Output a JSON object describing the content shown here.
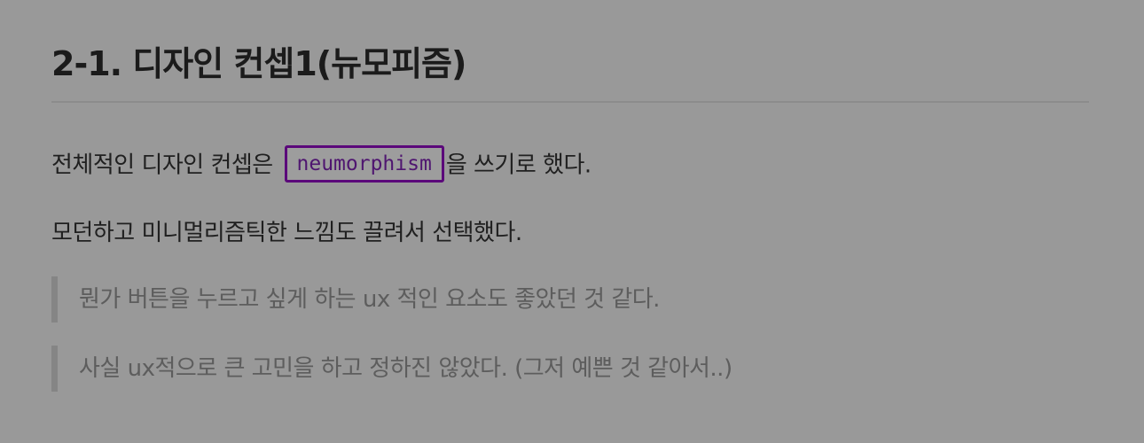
{
  "heading": {
    "title": "2-1. 디자인 컨셉1(뉴모피즘)"
  },
  "body": {
    "para1_before": "전체적인 디자인 컨셉은 ",
    "para1_code": "neumorphism",
    "para1_after": "을 쓰기로 했다.",
    "para2": "모던하고 미니멀리즘틱한 느낌도 끌려서 선택했다."
  },
  "quotes": [
    "뭔가 버튼을 누르고 싶게 하는 ux 적인 요소도 좋았던 것 같다.",
    "사실 ux적으로 큰 고민을 하고 정하진 않았다. (그저 예쁜 것 같아서..)"
  ],
  "colors": {
    "background": "#999999",
    "code_border": "#5b087a",
    "quote_bar": "#858585"
  }
}
